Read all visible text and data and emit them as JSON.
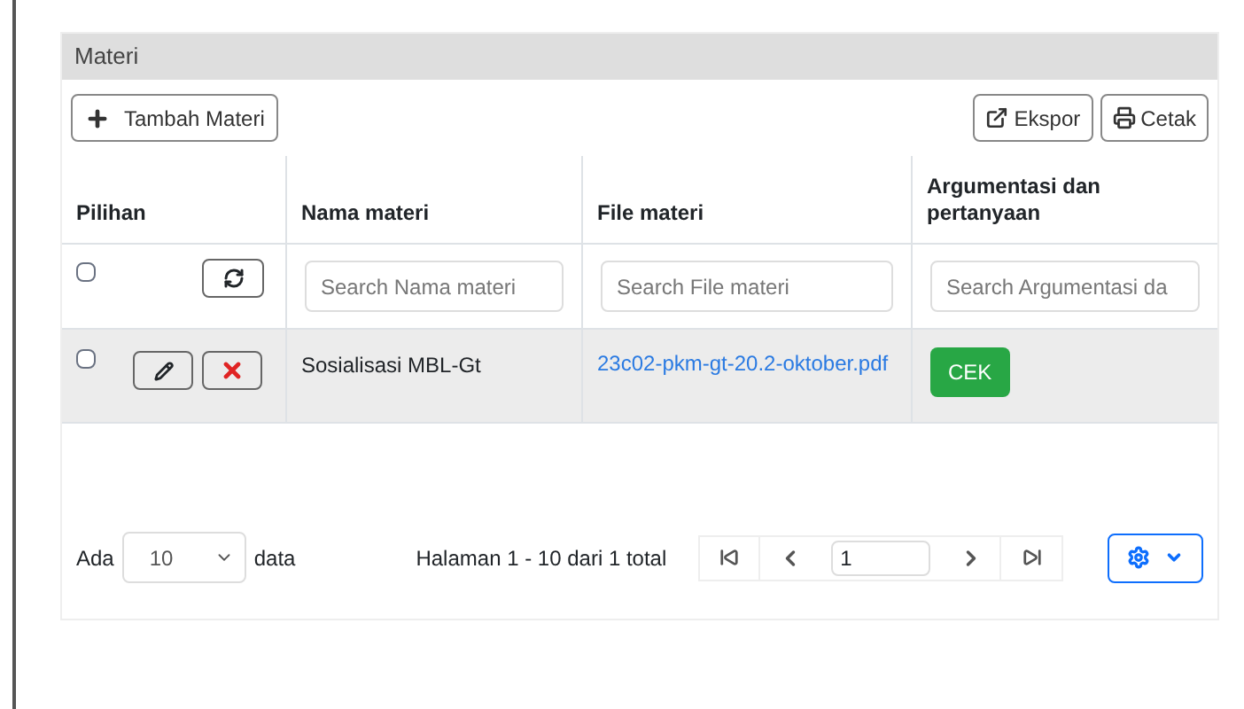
{
  "panel": {
    "title": "Materi"
  },
  "toolbar": {
    "add_button": "Tambah Materi",
    "export_button": "Ekspor",
    "print_button": "Cetak"
  },
  "table": {
    "columns": [
      "Pilihan",
      "Nama materi",
      "File materi",
      "Argumentasi dan pertanyaan"
    ],
    "filters": {
      "checked": false,
      "placeholders": [
        "Search Nama materi",
        "Search File materi",
        "Search Argumentasi da"
      ]
    },
    "rows": [
      {
        "checked": false,
        "name": "Sosialisasi MBL-Gt",
        "file": "23c02-pkm-gt-20.2-oktober.pdf",
        "action": "CEK"
      }
    ]
  },
  "footer": {
    "prefix": "Ada",
    "page_size": "10",
    "suffix": "data",
    "summary": "Halaman 1 - 10 dari 1 total",
    "page": "1"
  }
}
